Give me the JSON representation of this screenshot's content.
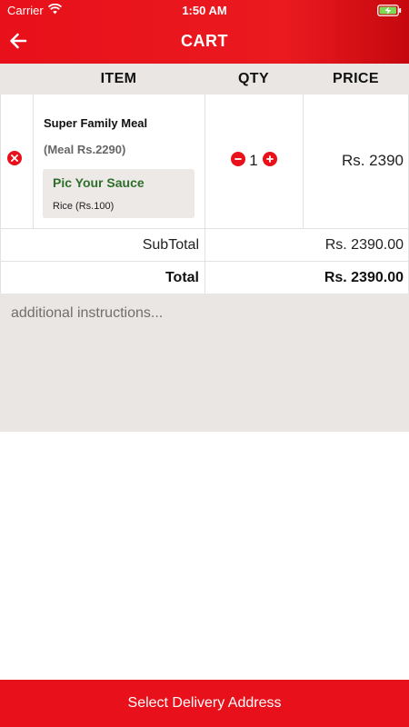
{
  "status_bar": {
    "carrier": "Carrier",
    "time": "1:50 AM",
    "wifi_icon": "wifi-icon",
    "battery_icon": "battery-charging-icon"
  },
  "nav": {
    "back_icon": "arrow-left-icon",
    "title": "CART"
  },
  "table": {
    "columns": [
      "ITEM",
      "QTY",
      "PRICE"
    ],
    "rows": [
      {
        "remove_icon": "remove-circle-x-icon",
        "name": "Super Family Meal",
        "meal_price": "(Meal Rs.2290)",
        "addon_group": "Pic Your Sauce",
        "addon_item": "Rice (Rs.100)",
        "quantity": "1",
        "price": "Rs. 2390"
      }
    ],
    "subtotal_label": "SubTotal",
    "subtotal_value": "Rs. 2390.00",
    "total_label": "Total",
    "total_value": "Rs. 2390.00"
  },
  "instructions": {
    "placeholder": "additional instructions...",
    "value": ""
  },
  "footer": {
    "button_label": "Select Delivery Address"
  },
  "colors": {
    "brand_red": "#e8101a",
    "panel_gray": "#e9e6e4",
    "addon_green": "#2f6e2b"
  }
}
